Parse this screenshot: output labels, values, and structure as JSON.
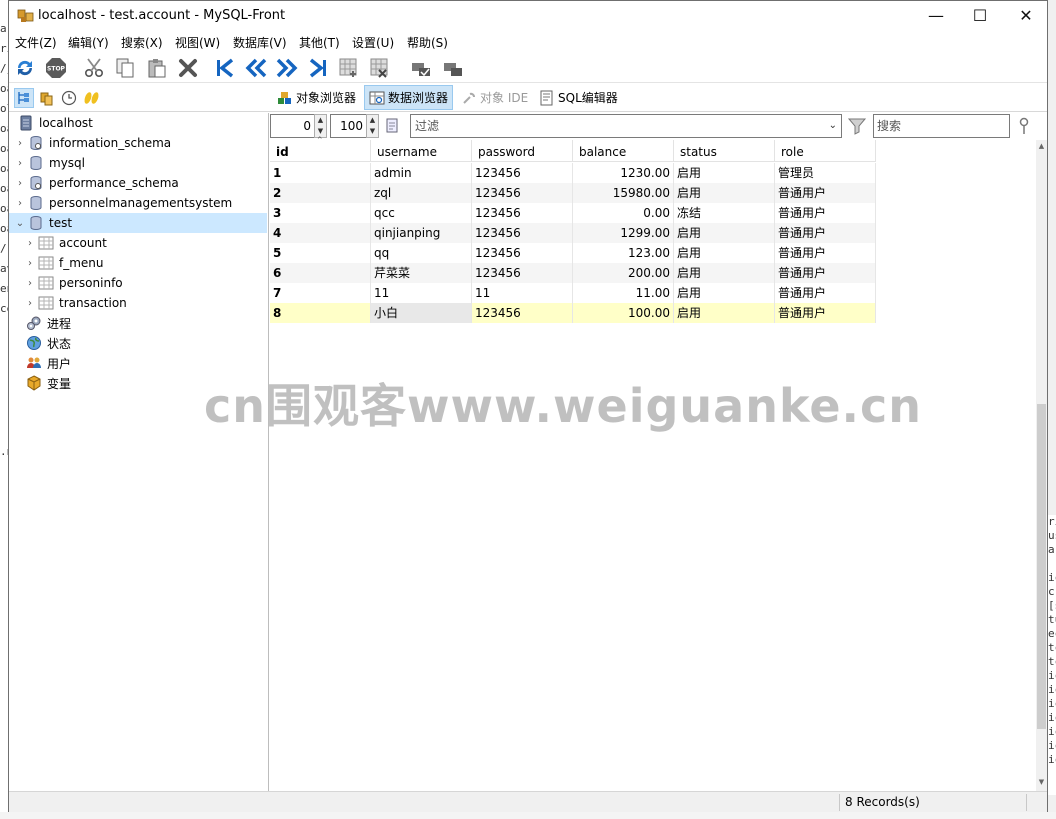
{
  "window": {
    "title": "localhost - test.account - MySQL-Front",
    "minimize": "—",
    "maximize": "☐",
    "close": "✕"
  },
  "menu": [
    "文件(Z)",
    "编辑(Y)",
    "搜索(X)",
    "视图(W)",
    "数据库(V)",
    "其他(T)",
    "设置(U)",
    "帮助(S)"
  ],
  "tabs": {
    "object_browser": "对象浏览器",
    "data_browser": "数据浏览器",
    "object_ide": "对象 IDE",
    "sql_editor": "SQL编辑器"
  },
  "tree": {
    "root": "localhost",
    "databases": [
      "information_schema",
      "mysql",
      "performance_schema",
      "personnelmanagementsystem",
      "test"
    ],
    "tables": [
      "account",
      "f_menu",
      "personinfo",
      "transaction"
    ],
    "extras": [
      "进程",
      "状态",
      "用户",
      "变量"
    ]
  },
  "filterbar": {
    "offset": "0",
    "limit": "100",
    "filter_placeholder": "过滤",
    "search_placeholder": "搜索"
  },
  "grid": {
    "columns": [
      "id",
      "username",
      "password",
      "balance",
      "status",
      "role"
    ],
    "rows": [
      [
        "1",
        "admin",
        "123456",
        "1230.00",
        "启用",
        "管理员"
      ],
      [
        "2",
        "zql",
        "123456",
        "15980.00",
        "启用",
        "普通用户"
      ],
      [
        "3",
        "qcc",
        "123456",
        "0.00",
        "冻结",
        "普通用户"
      ],
      [
        "4",
        "qinjianping",
        "123456",
        "1299.00",
        "启用",
        "普通用户"
      ],
      [
        "5",
        "qq",
        "123456",
        "123.00",
        "启用",
        "普通用户"
      ],
      [
        "6",
        "芹菜菜",
        "123456",
        "200.00",
        "启用",
        "普通用户"
      ],
      [
        "7",
        "11",
        "11",
        "11.00",
        "启用",
        "普通用户"
      ],
      [
        "8",
        "小白",
        "123456",
        "100.00",
        "启用",
        "普通用户"
      ]
    ]
  },
  "status": {
    "records": "8 Records(s)"
  },
  "watermark": "cn围观客www.weiguanke.cn",
  "colors": {
    "selection": "#cce8ff",
    "active_tab": "#cce4f7",
    "focused_row": "#ffffc8",
    "alt_row": "#f5f5f5",
    "toolbar_blue": "#1565c0"
  }
}
